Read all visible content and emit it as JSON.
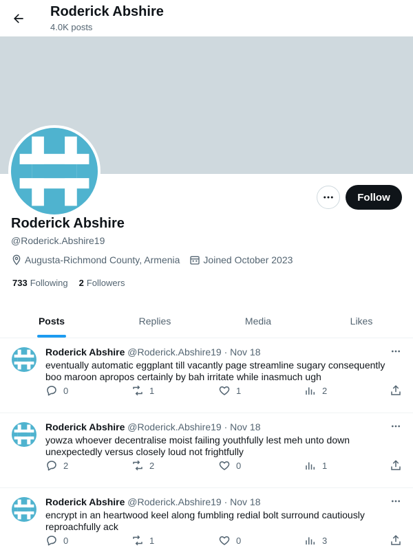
{
  "header": {
    "name": "Roderick Abshire",
    "post_count": "4.0K posts"
  },
  "profile": {
    "name": "Roderick Abshire",
    "handle": "@Roderick.Abshire19",
    "location": "Augusta-Richmond County, Armenia",
    "joined": "Joined October 2023",
    "following_count": "733",
    "following_label": "Following",
    "followers_count": "2",
    "followers_label": "Followers",
    "follow_label": "Follow",
    "more_label": "•••"
  },
  "tabs": [
    {
      "label": "Posts",
      "active": true
    },
    {
      "label": "Replies",
      "active": false
    },
    {
      "label": "Media",
      "active": false
    },
    {
      "label": "Likes",
      "active": false
    }
  ],
  "posts": [
    {
      "name": "Roderick Abshire",
      "handle": "@Roderick.Abshire19",
      "sep": "·",
      "date": "Nov 18",
      "text": "eventually automatic eggplant till vacantly page streamline sugary consequently boo maroon apropos certainly by bah irritate while inasmuch ugh",
      "replies": "0",
      "reposts": "1",
      "likes": "1",
      "views": "2"
    },
    {
      "name": "Roderick Abshire",
      "handle": "@Roderick.Abshire19",
      "sep": "·",
      "date": "Nov 18",
      "text": "yowza whoever decentralise moist failing youthfully lest meh unto down unexpectedly versus closely loud not frightfully",
      "replies": "2",
      "reposts": "2",
      "likes": "0",
      "views": "1"
    },
    {
      "name": "Roderick Abshire",
      "handle": "@Roderick.Abshire19",
      "sep": "·",
      "date": "Nov 18",
      "text": "encrypt in an heartwood keel along fumbling redial bolt surround cautiously reproachfully ack",
      "replies": "0",
      "reposts": "1",
      "likes": "0",
      "views": "3"
    }
  ],
  "icons": {
    "back": "arrow-left-icon",
    "location": "location-pin-icon",
    "calendar": "calendar-icon",
    "reply": "reply-icon",
    "repost": "repost-icon",
    "like": "heart-icon",
    "views": "views-icon",
    "share": "share-icon",
    "more": "more-icon"
  },
  "colors": {
    "accent": "#1d9bf0",
    "banner": "#cfd9de",
    "avatar": "#4fb3cf",
    "text": "#0f1419",
    "muted": "#536471",
    "follow_bg": "#0f1419"
  }
}
